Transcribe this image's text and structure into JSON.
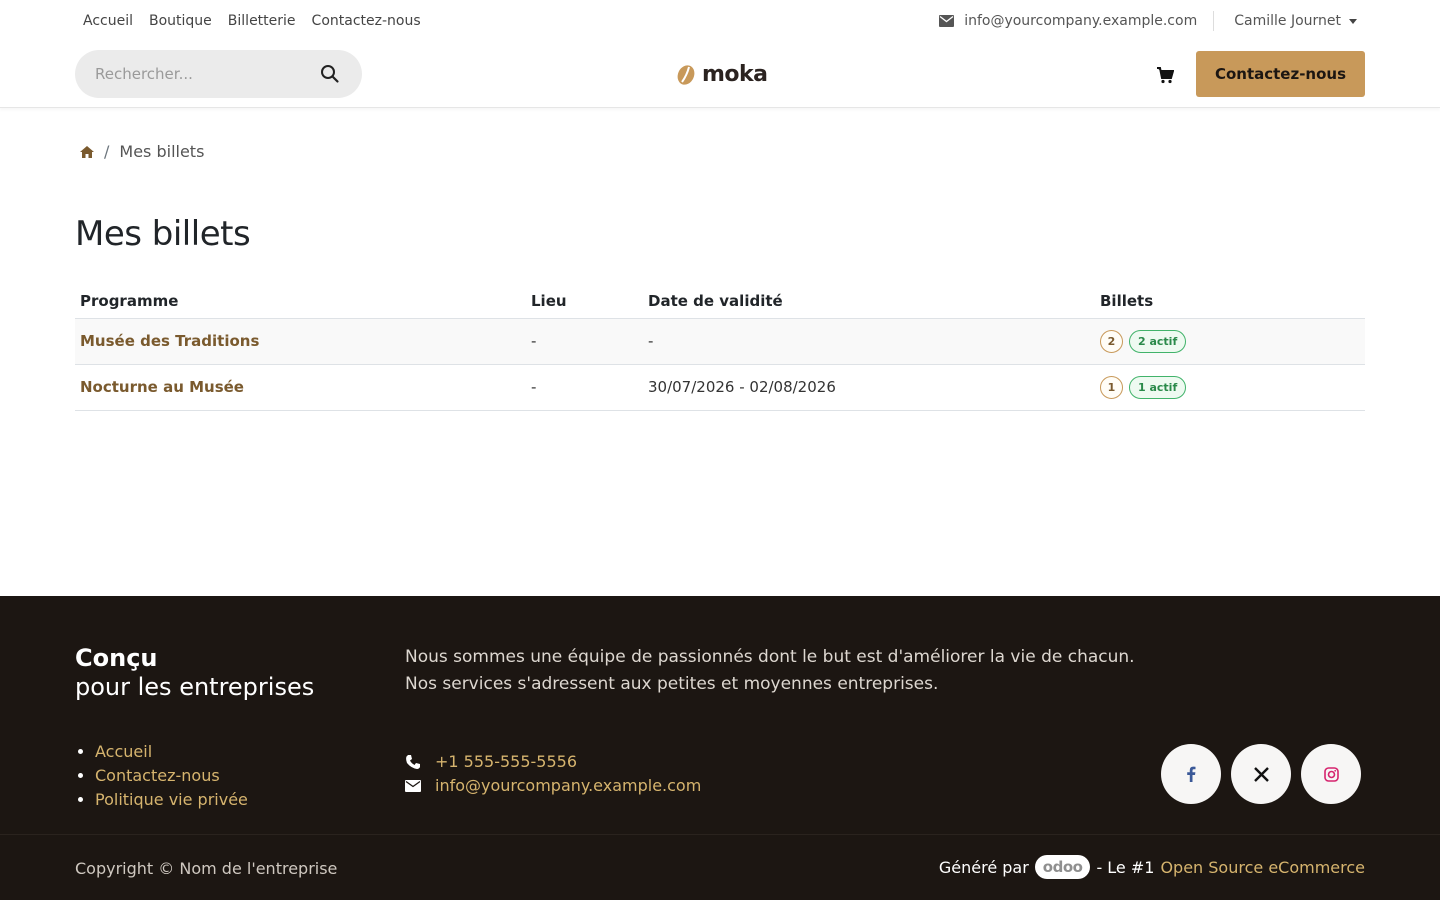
{
  "topnav": {
    "items": [
      "Accueil",
      "Boutique",
      "Billetterie",
      "Contactez-nous"
    ]
  },
  "contact": {
    "email": "info@yourcompany.example.com",
    "user": "Camille Journet"
  },
  "search": {
    "placeholder": "Rechercher..."
  },
  "logo": {
    "text": "moka"
  },
  "header": {
    "cta_label": "Contactez-nous"
  },
  "breadcrumb": {
    "current": "Mes billets",
    "separator": "/"
  },
  "page": {
    "title": "Mes billets"
  },
  "table": {
    "headers": [
      "Programme",
      "Lieu",
      "Date de validité",
      "Billets"
    ],
    "rows": [
      {
        "programme": "Musée des Traditions",
        "lieu": "-",
        "date": "-",
        "count": "2",
        "active": "2 actif"
      },
      {
        "programme": "Nocturne au Musée",
        "lieu": "-",
        "date": "30/07/2026 - 02/08/2026",
        "count": "1",
        "active": "1 actif"
      }
    ]
  },
  "footer": {
    "heading_line1": "Conçu",
    "heading_line2": "pour les entreprises",
    "links": [
      "Accueil",
      "Contactez-nous",
      "Politique vie privée"
    ],
    "description_line1": "Nous sommes une équipe de passionnés dont le but est d'améliorer la vie de chacun.",
    "description_line2": "Nos services s'adressent aux petites et moyennes entreprises.",
    "phone": "+1 555-555-5556",
    "email": "info@yourcompany.example.com",
    "social": [
      "facebook-icon",
      "x-icon",
      "instagram-icon"
    ],
    "copyright": "Copyright © Nom de l'entreprise",
    "powered_prefix": "Généré par",
    "powered_brand": "odoo",
    "powered_middle": "- Le #1",
    "powered_link": "Open Source eCommerce"
  },
  "colors": {
    "accent": "#c8995a",
    "link": "#7a5a2e",
    "footer_bg": "#1c1612",
    "footer_link": "#d6b46e",
    "success": "#41b36a"
  }
}
